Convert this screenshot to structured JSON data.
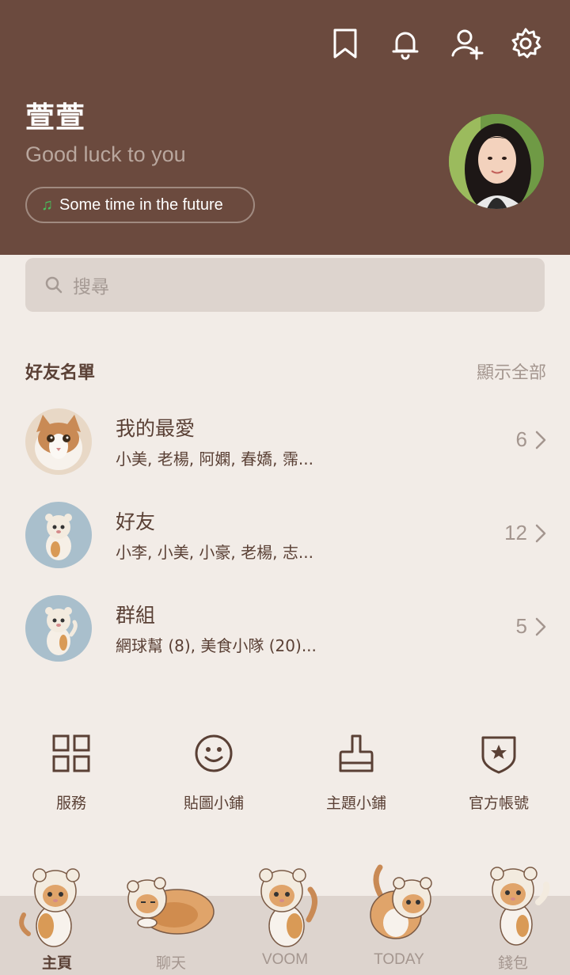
{
  "profile": {
    "name": "萱萱",
    "status": "Good luck to you",
    "music": "Some time in the future"
  },
  "header_icons": [
    "bookmark-icon",
    "bell-icon",
    "add-friend-icon",
    "gear-icon"
  ],
  "search": {
    "placeholder": "搜尋"
  },
  "friends": {
    "title": "好友名單",
    "show_all": "顯示全部",
    "rows": [
      {
        "title": "我的最愛",
        "subtitle": "小美, 老楊, 阿嫻, 春嬌, 霈...",
        "count": "6"
      },
      {
        "title": "好友",
        "subtitle": "小李, 小美, 小豪, 老楊, 志...",
        "count": "12"
      },
      {
        "title": "群組",
        "subtitle": "網球幫 (8), 美食小隊 (20)...",
        "count": "5"
      }
    ]
  },
  "shortcuts": [
    {
      "label": "服務",
      "icon": "grid-icon"
    },
    {
      "label": "貼圖小鋪",
      "icon": "smiley-icon"
    },
    {
      "label": "主題小鋪",
      "icon": "brush-icon"
    },
    {
      "label": "官方帳號",
      "icon": "shield-star-icon"
    }
  ],
  "nav": [
    {
      "label": "主頁",
      "active": true
    },
    {
      "label": "聊天",
      "active": false
    },
    {
      "label": "VOOM",
      "active": false
    },
    {
      "label": "TODAY",
      "active": false
    },
    {
      "label": "錢包",
      "active": false
    }
  ],
  "colors": {
    "header_bg": "#6b4a3e",
    "page_bg": "#f2ece7",
    "text_primary": "#5a4035",
    "text_muted": "#a4968f",
    "music_note": "#47c15c"
  }
}
